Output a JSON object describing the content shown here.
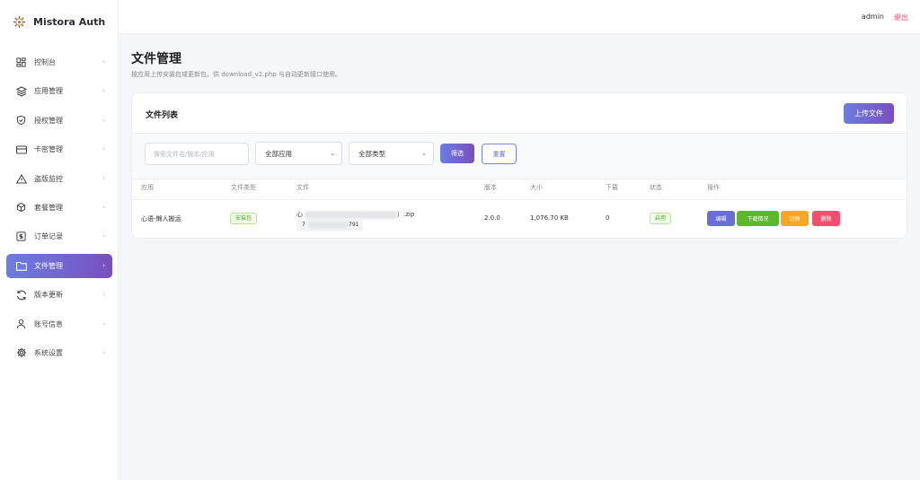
{
  "app": {
    "title": "Mistora Auth"
  },
  "header": {
    "user": "admin",
    "logout": "退出"
  },
  "sidebar": {
    "items": [
      {
        "label": "控制台",
        "icon": "dashboard-icon"
      },
      {
        "label": "应用管理",
        "icon": "layers-icon"
      },
      {
        "label": "授权管理",
        "icon": "shield-check-icon"
      },
      {
        "label": "卡密管理",
        "icon": "credit-card-icon"
      },
      {
        "label": "盗版监控",
        "icon": "warning-icon"
      },
      {
        "label": "套餐管理",
        "icon": "package-icon"
      },
      {
        "label": "订单记录",
        "icon": "receipt-icon"
      },
      {
        "label": "文件管理",
        "icon": "folder-icon",
        "active": true
      },
      {
        "label": "版本更新",
        "icon": "refresh-icon"
      },
      {
        "label": "账号信息",
        "icon": "user-icon"
      },
      {
        "label": "系统设置",
        "icon": "gear-icon"
      }
    ]
  },
  "page": {
    "title": "文件管理",
    "description": "按应用上传安装包或更新包。供 download_v2.php 与自动更新接口使用。"
  },
  "card": {
    "title": "文件列表",
    "upload_label": "上传文件",
    "filters": {
      "search_placeholder": "搜索文件名/版本/应用",
      "app_select": "全部应用",
      "type_select": "全部类型",
      "filter_label": "筛选",
      "reset_label": "重置"
    },
    "table": {
      "headers": [
        "应用",
        "文件类型",
        "文件",
        "版本",
        "大小",
        "下载",
        "状态",
        "操作"
      ],
      "rows": [
        {
          "app": "心语-懒人搬运",
          "type": "安装包",
          "file_prefix": "心",
          "file_suffix": "）.zip",
          "code_prefix": "7",
          "code_suffix": "791",
          "version": "2.0.0",
          "size": "1,076.70 KB",
          "downloads": "0",
          "status": "启用",
          "actions": {
            "edit": "编辑",
            "download_stats": "下载情况",
            "toggle": "切换",
            "delete": "删除"
          }
        }
      ]
    }
  },
  "colors": {
    "accent_start": "#6b7de0",
    "accent_end": "#7a4fbf",
    "danger": "#f0506e",
    "success": "#52a51f",
    "warning": "#f5a623"
  }
}
